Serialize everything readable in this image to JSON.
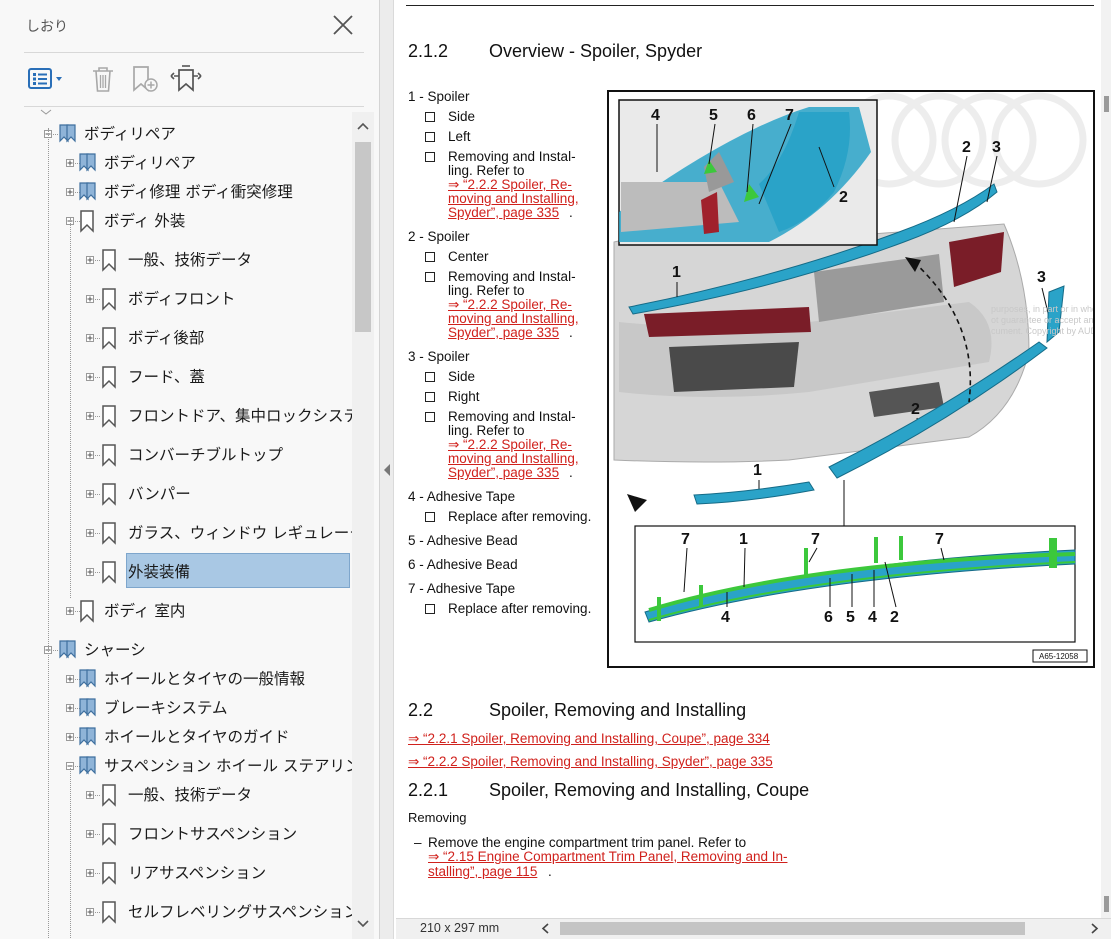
{
  "panel": {
    "title": "しおり",
    "tree": [
      {
        "label": "ボディリペア",
        "level": 0,
        "kind": "book",
        "expanded": true
      },
      {
        "label": "ボディリペア",
        "level": 1,
        "kind": "book",
        "expanded": false
      },
      {
        "label": "ボディ修理  ボディ衝突修理",
        "level": 1,
        "kind": "book",
        "expanded": false
      },
      {
        "label": "ボディ  外装",
        "level": 1,
        "kind": "bookmark",
        "expanded": true
      },
      {
        "label": "一般、技術データ",
        "level": 2,
        "kind": "bookmark",
        "expanded": false
      },
      {
        "label": "ボディフロント",
        "level": 2,
        "kind": "bookmark",
        "expanded": false
      },
      {
        "label": "ボディ後部",
        "level": 2,
        "kind": "bookmark",
        "expanded": false
      },
      {
        "label": "フード、蓋",
        "level": 2,
        "kind": "bookmark",
        "expanded": false
      },
      {
        "label": "フロントドア、集中ロックシステム",
        "level": 2,
        "kind": "bookmark",
        "expanded": false
      },
      {
        "label": "コンバーチブルトップ",
        "level": 2,
        "kind": "bookmark",
        "expanded": false
      },
      {
        "label": "バンパー",
        "level": 2,
        "kind": "bookmark",
        "expanded": false
      },
      {
        "label": "ガラス、ウィンドウ レギュレーター",
        "level": 2,
        "kind": "bookmark",
        "expanded": false
      },
      {
        "label": "外装装備",
        "level": 2,
        "kind": "bookmark",
        "expanded": false,
        "selected": true
      },
      {
        "label": "ボディ  室内",
        "level": 1,
        "kind": "bookmark",
        "expanded": false
      },
      {
        "label": "シャーシ",
        "level": 0,
        "kind": "book",
        "expanded": true
      },
      {
        "label": "ホイールとタイヤの一般情報",
        "level": 1,
        "kind": "book",
        "expanded": false
      },
      {
        "label": "ブレーキシステム",
        "level": 1,
        "kind": "book",
        "expanded": false
      },
      {
        "label": "ホイールとタイヤのガイド",
        "level": 1,
        "kind": "book",
        "expanded": false
      },
      {
        "label": "サスペンション  ホイール  ステアリング",
        "level": 1,
        "kind": "book",
        "expanded": true
      },
      {
        "label": "一般、技術データ",
        "level": 2,
        "kind": "bookmark",
        "expanded": false
      },
      {
        "label": "フロントサスペンション",
        "level": 2,
        "kind": "bookmark",
        "expanded": false
      },
      {
        "label": "リアサスペンション",
        "level": 2,
        "kind": "bookmark",
        "expanded": false
      },
      {
        "label": "セルフレベリングサスペンション",
        "level": 2,
        "kind": "bookmark",
        "expanded": false
      }
    ],
    "icons": {
      "close": "close-icon",
      "options": "bookmark-options-icon",
      "delete": "delete-bookmark-icon",
      "add": "add-bookmark-icon",
      "find": "find-current-bookmark-icon"
    }
  },
  "doc": {
    "heading_212_num": "2.1.2",
    "heading_212_title": "Overview - Spoiler, Spyder",
    "legend": [
      {
        "title": "1 - Spoiler",
        "items": [
          {
            "text": "Side"
          },
          {
            "text": "Left"
          },
          {
            "text": "Removing and Instal-",
            "text2": "ling. Refer to",
            "link": [
              "⇒ “2.2.2 Spoiler, Re-",
              "moving and Installing,",
              "Spyder”, page 335"
            ],
            "tail": "."
          }
        ]
      },
      {
        "title": "2 - Spoiler",
        "items": [
          {
            "text": "Center"
          },
          {
            "text": "Removing and Instal-",
            "text2": "ling. Refer to",
            "link": [
              "⇒ “2.2.2 Spoiler, Re-",
              "moving and Installing,",
              "Spyder”, page 335"
            ],
            "tail": "."
          }
        ]
      },
      {
        "title": "3 - Spoiler",
        "items": [
          {
            "text": "Side"
          },
          {
            "text": "Right"
          },
          {
            "text": "Removing and Instal-",
            "text2": "ling. Refer to",
            "link": [
              "⇒ “2.2.2 Spoiler, Re-",
              "moving and Installing,",
              "Spyder”, page 335"
            ],
            "tail": "."
          }
        ]
      },
      {
        "title": "4 - Adhesive Tape",
        "items": [
          {
            "text": "Replace after removing."
          }
        ]
      },
      {
        "title": "5 - Adhesive Bead",
        "items": []
      },
      {
        "title": "6 - Adhesive Bead",
        "items": []
      },
      {
        "title": "7 - Adhesive Tape",
        "items": [
          {
            "text": "Replace after removing."
          }
        ]
      }
    ],
    "figure": {
      "callouts_inset": [
        "4",
        "5",
        "6",
        "7",
        "2"
      ],
      "callouts_main": [
        "2",
        "3",
        "1",
        "3",
        "2",
        "1"
      ],
      "callouts_detail": [
        "7",
        "1",
        "7",
        "7",
        "4",
        "6",
        "5",
        "4",
        "2"
      ],
      "code": "A65-12058",
      "watermark_lines": [
        "purposes, in part or in whole",
        "ot guarantee or accept any",
        "cument. Copyright by AUDI"
      ]
    },
    "heading_22_num": "2.2",
    "heading_22_title": "Spoiler, Removing and Installing",
    "links_22": [
      "⇒ “2.2.1 Spoiler, Removing and Installing, Coupe”, page 334",
      "⇒ “2.2.2 Spoiler, Removing and Installing, Spyder”, page 335"
    ],
    "heading_221_num": "2.2.1",
    "heading_221_title": "Spoiler, Removing and Installing, Coupe",
    "removing": "Removing",
    "step_dash": "–",
    "step_text": "Remove the engine compartment trim panel. Refer to",
    "step_link": [
      "⇒ “2.15 Engine Compartment Trim Panel, Removing and In-",
      "stalling”, page 115"
    ],
    "step_tail": "."
  },
  "status": {
    "page_size": "210 x 297 mm"
  },
  "colors": {
    "selection": "#a9c8e4",
    "link": "#d0211c",
    "spoiler": "#2aa3c8",
    "tape": "#3cc83c",
    "icon_blue": "#2a6fb8"
  }
}
